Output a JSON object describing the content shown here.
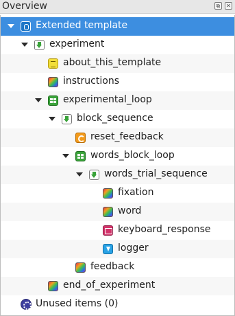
{
  "panel": {
    "title": "Overview",
    "float_button": "⧉",
    "close_button": "✕"
  },
  "tree": {
    "rows": [
      {
        "label": "Extended template",
        "icon": "template-icon",
        "expanded": true,
        "selected": true
      },
      {
        "label": "experiment",
        "icon": "sequence-icon",
        "expanded": true
      },
      {
        "label": "about_this_template",
        "icon": "notepad-icon"
      },
      {
        "label": "instructions",
        "icon": "sketchpad-icon"
      },
      {
        "label": "experimental_loop",
        "icon": "loop-icon",
        "expanded": true
      },
      {
        "label": "block_sequence",
        "icon": "sequence-icon",
        "expanded": true
      },
      {
        "label": "reset_feedback",
        "icon": "reset-feedback-icon"
      },
      {
        "label": "words_block_loop",
        "icon": "loop-icon",
        "expanded": true
      },
      {
        "label": "words_trial_sequence",
        "icon": "sequence-icon",
        "expanded": true
      },
      {
        "label": "fixation",
        "icon": "sketchpad-icon"
      },
      {
        "label": "word",
        "icon": "sketchpad-icon"
      },
      {
        "label": "keyboard_response",
        "icon": "keyboard-icon"
      },
      {
        "label": "logger",
        "icon": "logger-icon"
      },
      {
        "label": "feedback",
        "icon": "feedback-icon"
      },
      {
        "label": "end_of_experiment",
        "icon": "sketchpad-icon"
      },
      {
        "label": "Unused items (0)",
        "icon": "unused-items-icon"
      }
    ]
  },
  "colors": {
    "selection": "#3d8ee0",
    "titlebar": "#e7e7e7"
  }
}
